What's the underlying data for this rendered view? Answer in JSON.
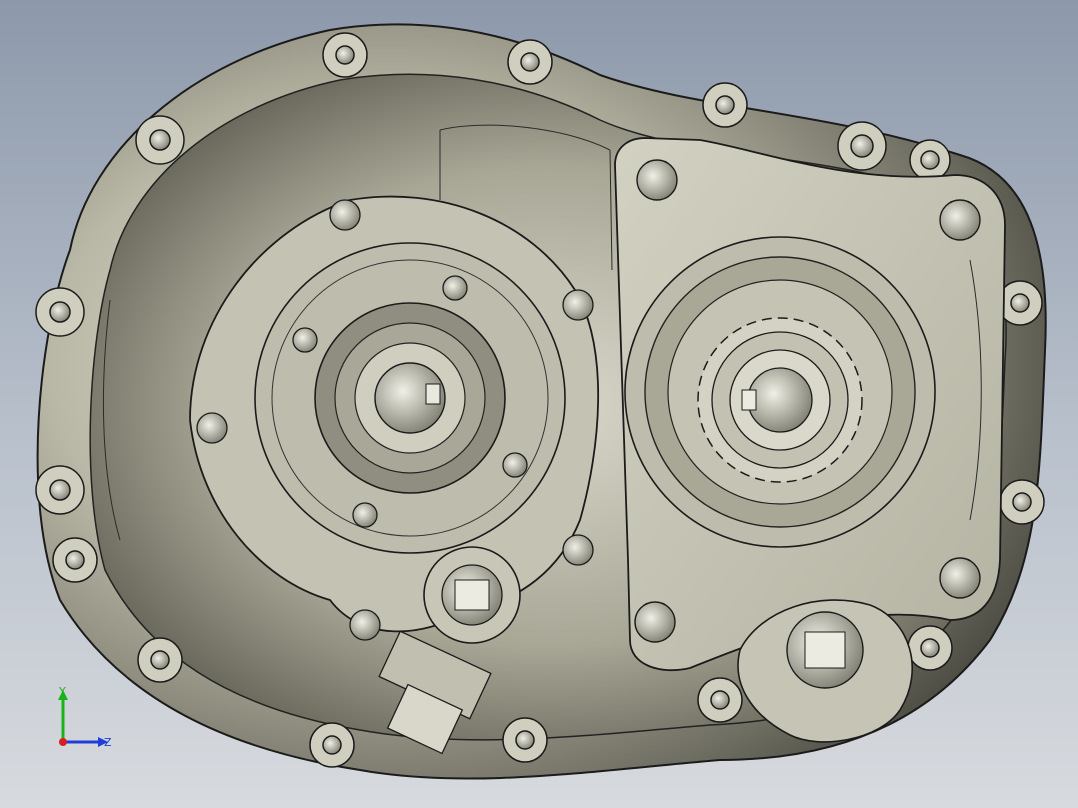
{
  "viewport": {
    "background_top": "#8d99ab",
    "background_bottom": "#d7dade"
  },
  "triad": {
    "y_label": "Y",
    "z_label": "Z",
    "y_color": "#19b219",
    "z_color": "#1f3ddb",
    "x_color": "#d61f1f"
  },
  "model": {
    "metal_color": "#b9b9a6",
    "cover_color": "#c9c8b8",
    "edge_color": "#1b1b1b"
  }
}
